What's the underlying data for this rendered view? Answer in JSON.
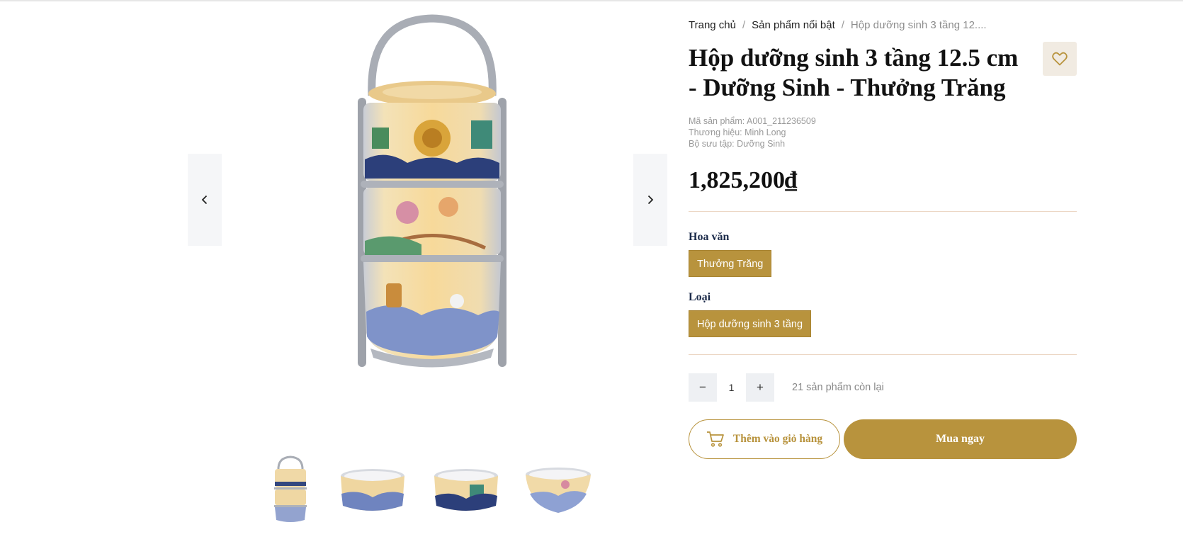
{
  "breadcrumb": {
    "home": "Trang chủ",
    "category": "Sản phẩm nổi bật",
    "current": "Hộp dưỡng sinh 3 tầng 12....",
    "separator": "/"
  },
  "product": {
    "title": "Hộp dưỡng sinh 3 tầng 12.5 cm\n- Dưỡng Sinh - Thưởng Trăng",
    "sku": "Mã sản phẩm: A001_211236509",
    "brand": "Thương hiệu: Minh Long",
    "collection": "Bộ sưu tập: Dưỡng Sinh",
    "price": "1,825,200₫"
  },
  "gallery": {
    "main_image": "three-tier-porcelain-lunch-box-image",
    "prev_icon": "chevron-left-icon",
    "next_icon": "chevron-right-icon",
    "thumbnails": [
      "three-tier-box-thumbnail",
      "bowl-thumbnail",
      "bowl-thumbnail",
      "rounded-bowl-thumbnail"
    ]
  },
  "options": {
    "pattern_label": "Hoa văn",
    "pattern_value": "Thưởng Trăng",
    "type_label": "Loại",
    "type_value": "Hộp dưỡng sinh 3 tầng"
  },
  "quantity": {
    "minus": "−",
    "value": "1",
    "plus": "+",
    "stock": "21 sản phẩm còn lại"
  },
  "actions": {
    "add_to_cart": "Thêm vào giỏ hàng",
    "buy_now": "Mua ngay",
    "cart_icon": "cart-icon",
    "wishlist_icon": "heart-icon"
  },
  "colors": {
    "accent": "#b8933d",
    "wishlist_bg": "#f1ebe2",
    "divider": "#ecd7c4",
    "nav_bg": "#f5f6f8"
  }
}
